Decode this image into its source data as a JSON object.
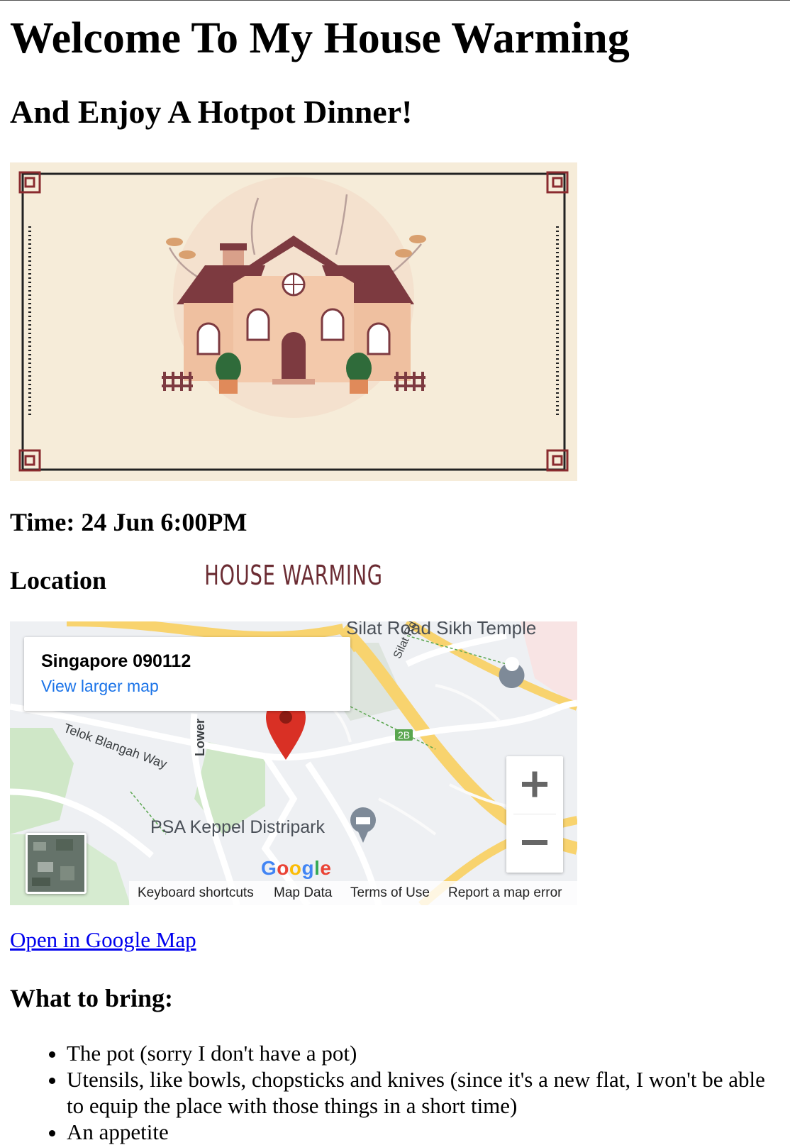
{
  "page": {
    "title": "Welcome To My House Warming",
    "subtitle": "And Enjoy A Hotpot Dinner!",
    "banner_text": "HOUSE WARMING",
    "time_heading": "Time: 24 Jun 6:00PM",
    "location_heading": "Location",
    "open_map_link": "Open in Google Map",
    "bring_heading": "What to bring:",
    "bring_items": [
      "The pot (sorry I don't have a pot)",
      "Utensils, like bowls, chopsticks and knives (since it's a new flat, I won't be able to equip the place with those things in a short time)",
      "An appetite"
    ]
  },
  "map": {
    "place_name": "Singapore 090112",
    "view_larger": "View larger map",
    "labels": {
      "temple": "Silat Road Sikh Temple",
      "silat_rd": "Silat Rd",
      "telok": "Telok Blangah Way",
      "lower": "Lower",
      "psa": "PSA Keppel Distripark",
      "badge_2b": "2B"
    },
    "zoom_in": "+",
    "zoom_out": "−",
    "google": [
      "G",
      "o",
      "o",
      "g",
      "l",
      "e"
    ],
    "google_colors": [
      "#4285F4",
      "#EA4335",
      "#FBBC05",
      "#4285F4",
      "#34A853",
      "#EA4335"
    ],
    "footer": {
      "keyboard": "Keyboard shortcuts",
      "data": "Map Data",
      "terms": "Terms of Use",
      "report": "Report a map error"
    },
    "icons": [
      "map-pin-icon",
      "temple-icon",
      "museum-icon",
      "zoom-in-icon",
      "zoom-out-icon",
      "satellite-thumbnail"
    ]
  },
  "colors": {
    "link": "#0000ee",
    "map_link": "#1a73e8",
    "pin": "#d93025",
    "banner_bg": "#f6ecd9",
    "roof": "#7d3a40",
    "wall": "#efc0a0"
  }
}
